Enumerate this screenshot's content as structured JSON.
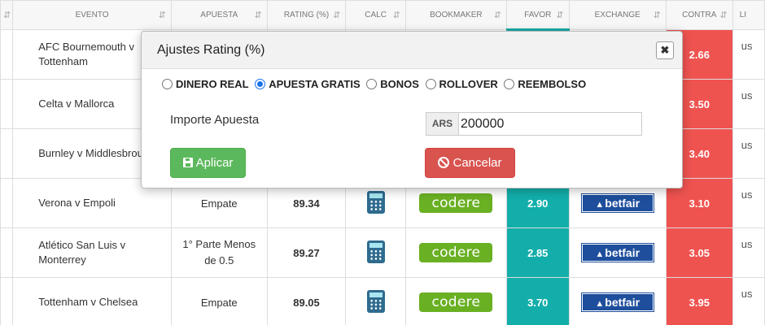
{
  "table": {
    "headers": {
      "evento": "EVENTO",
      "apuesta": "APUESTA",
      "rating": "RATING (%)",
      "calc": "CALC",
      "bookmaker": "BOOKMAKER",
      "favor": "FAVOR",
      "exchange": "EXCHANGE",
      "contra": "CONTRA",
      "liquidez": "LI"
    },
    "rows": [
      {
        "evento": "AFC Bournemouth v Tottenham",
        "apuesta": "",
        "rating": "",
        "favor": "",
        "contra": "2.66",
        "liq": "us"
      },
      {
        "evento": "Celta v Mallorca",
        "apuesta": "",
        "rating": "",
        "favor": "",
        "contra": "3.50",
        "liq": "us"
      },
      {
        "evento": "Burnley v Middlesbrough",
        "apuesta": "",
        "rating": "",
        "favor": "",
        "contra": "3.40",
        "liq": "us"
      },
      {
        "evento": "Verona v Empoli",
        "apuesta": "Empate",
        "rating": "89.34",
        "bookmaker": "codere",
        "favor": "2.90",
        "exchange": "betfair",
        "contra": "3.10",
        "liq": "us"
      },
      {
        "evento": "Atlético San Luis v Monterrey",
        "apuesta": "1° Parte Menos de 0.5",
        "rating": "89.27",
        "bookmaker": "codere",
        "favor": "2.85",
        "exchange": "betfair",
        "contra": "3.05",
        "liq": "us"
      },
      {
        "evento": "Tottenham v Chelsea",
        "apuesta": "Empate",
        "rating": "89.05",
        "bookmaker": "codere",
        "favor": "3.70",
        "exchange": "betfair",
        "contra": "3.95",
        "liq": "us"
      }
    ]
  },
  "modal": {
    "title": "Ajustes Rating (%)",
    "close": "✖",
    "options": [
      "DINERO REAL",
      "APUESTA GRATIS",
      "BONOS",
      "ROLLOVER",
      "REEMBOLSO"
    ],
    "selected": "APUESTA GRATIS",
    "importe_label": "Importe Apuesta",
    "currency": "ARS",
    "amount": "200000",
    "apply": "Aplicar",
    "cancel": "Cancelar"
  },
  "colors": {
    "favor": "#13aeaa",
    "contra": "#ef5350",
    "apply": "#5cb85c",
    "cancel": "#d9534f",
    "codere": "#6ab023",
    "betfair": "#1e4e9c"
  },
  "icons": {
    "sort": "sort-icon",
    "calculator": "calculator-icon",
    "save": "floppy-disk-icon",
    "cancel": "ban-icon",
    "close": "close-icon"
  }
}
